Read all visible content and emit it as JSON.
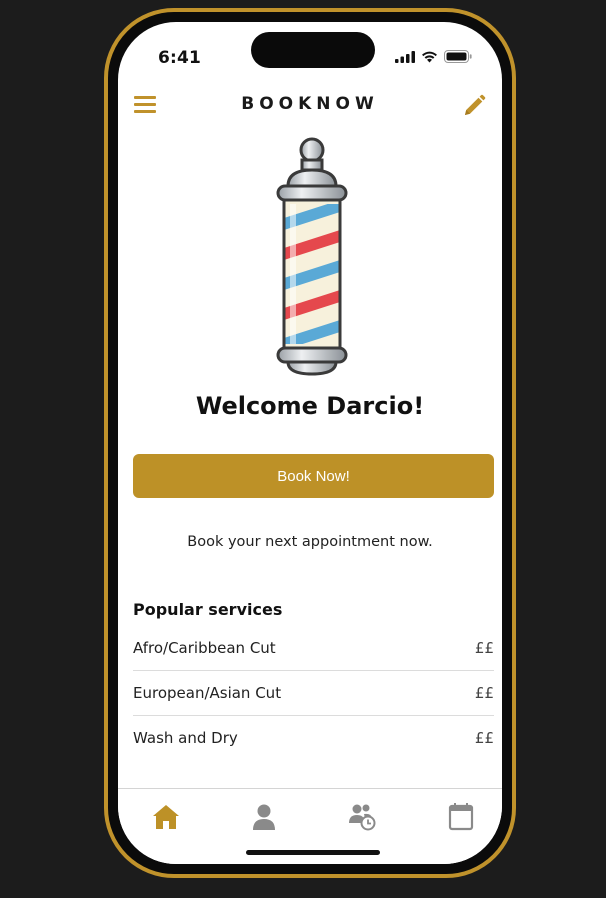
{
  "status_bar": {
    "time": "6:41"
  },
  "header": {
    "title": "BOOKNOW"
  },
  "welcome_text": "Welcome Darcio!",
  "book_button_label": "Book Now!",
  "subtitle": "Book your next appointment now.",
  "popular": {
    "title": "Popular services",
    "items": [
      {
        "name": "Afro/Caribbean Cut",
        "price": "££"
      },
      {
        "name": "European/Asian Cut",
        "price": "££"
      },
      {
        "name": "Wash and Dry",
        "price": "££"
      }
    ]
  },
  "tabs": [
    {
      "icon": "home-icon",
      "active": true
    },
    {
      "icon": "user-icon",
      "active": false
    },
    {
      "icon": "users-clock-icon",
      "active": false
    },
    {
      "icon": "calendar-icon",
      "active": false
    }
  ],
  "colors": {
    "accent": "#bd9127",
    "frame": "#c0922b",
    "inactive_icon": "#8a8a8a"
  }
}
